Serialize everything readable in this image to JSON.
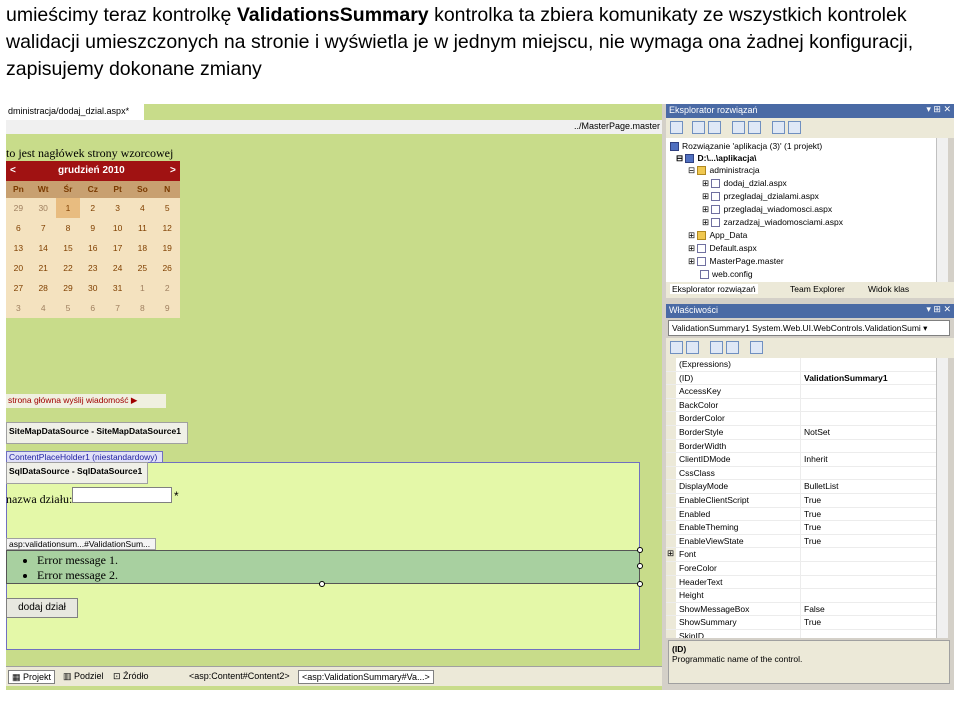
{
  "caption": {
    "part1": "umieścimy teraz kontrolkę ",
    "bold": "ValidationsSummary",
    "part2": " kontrolka ta zbiera komunikaty ze wszystkich kontrolek walidacji umieszczonych na stronie i wyświetla je w jednym miejscu, nie wymaga ona żadnej konfiguracji, zapisujemy dokonane zmiany"
  },
  "designer": {
    "doc_tab": "dministracja/dodaj_dzial.aspx*",
    "master_path": "../MasterPage.master",
    "master_heading": "to jest nagłówek strony wzorcowej",
    "calendar": {
      "prev": "<",
      "title": "grudzień 2010",
      "next": ">",
      "days": [
        "Pn",
        "Wt",
        "Śr",
        "Cz",
        "Pt",
        "So",
        "N"
      ],
      "weeks": [
        [
          "29",
          "30",
          "1",
          "2",
          "3",
          "4",
          "5"
        ],
        [
          "6",
          "7",
          "8",
          "9",
          "10",
          "11",
          "12"
        ],
        [
          "13",
          "14",
          "15",
          "16",
          "17",
          "18",
          "19"
        ],
        [
          "20",
          "21",
          "22",
          "23",
          "24",
          "25",
          "26"
        ],
        [
          "27",
          "28",
          "29",
          "30",
          "31",
          "1",
          "2"
        ],
        [
          "3",
          "4",
          "5",
          "6",
          "7",
          "8",
          "9"
        ]
      ]
    },
    "menu": "strona główna   wyślij wiadomość ▶",
    "sitemap_ds": "SiteMapDataSource - SiteMapDataSource1",
    "cph_label": "ContentPlaceHolder1 (niestandardowy)",
    "sql_ds": "SqlDataSource - SqlDataSource1",
    "field_label": "nazwa działu:",
    "field_star": "*",
    "vs_label": "asp:validationsum...#ValidationSum...",
    "errors": [
      "Error message 1.",
      "Error message 2."
    ],
    "add_button": "dodaj dział",
    "bottom_tabs": [
      "Projekt",
      "Podziel",
      "Źródło"
    ],
    "breadcrumbs": [
      "<asp:Content#Content2>",
      "<asp:ValidationSummary#Va...>"
    ]
  },
  "solution": {
    "title": "Eksplorator rozwiązań",
    "controls": "▾ ⊞ ✕",
    "items": [
      "Rozwiązanie 'aplikacja (3)' (1 projekt)",
      "D:\\...\\aplikacja\\",
      "administracja",
      "dodaj_dzial.aspx",
      "przegladaj_dzialami.aspx",
      "przegladaj_wiadomosci.aspx",
      "zarzadzaj_wiadomosciami.aspx",
      "App_Data",
      "Default.aspx",
      "MasterPage.master",
      "web.config"
    ],
    "tabs": [
      "Eksplorator rozwiązań",
      "Team Explorer",
      "Widok klas"
    ]
  },
  "properties": {
    "title": "Właściwości",
    "controls": "▾ ⊞ ✕",
    "object": "ValidationSummary1  System.Web.UI.WebControls.ValidationSumi ▾",
    "rows": [
      {
        "name": "(Expressions)",
        "value": ""
      },
      {
        "name": "(ID)",
        "value": "ValidationSummary1"
      },
      {
        "name": "AccessKey",
        "value": ""
      },
      {
        "name": "BackColor",
        "value": ""
      },
      {
        "name": "BorderColor",
        "value": ""
      },
      {
        "name": "BorderStyle",
        "value": "NotSet"
      },
      {
        "name": "BorderWidth",
        "value": ""
      },
      {
        "name": "ClientIDMode",
        "value": "Inherit"
      },
      {
        "name": "CssClass",
        "value": ""
      },
      {
        "name": "DisplayMode",
        "value": "BulletList"
      },
      {
        "name": "EnableClientScript",
        "value": "True"
      },
      {
        "name": "Enabled",
        "value": "True"
      },
      {
        "name": "EnableTheming",
        "value": "True"
      },
      {
        "name": "EnableViewState",
        "value": "True"
      },
      {
        "name": "Font",
        "value": ""
      },
      {
        "name": "ForeColor",
        "value": ""
      },
      {
        "name": "HeaderText",
        "value": ""
      },
      {
        "name": "Height",
        "value": ""
      },
      {
        "name": "ShowMessageBox",
        "value": "False"
      },
      {
        "name": "ShowSummary",
        "value": "True"
      },
      {
        "name": "SkinID",
        "value": ""
      }
    ],
    "desc_title": "(ID)",
    "desc_text": "Programmatic name of the control."
  }
}
